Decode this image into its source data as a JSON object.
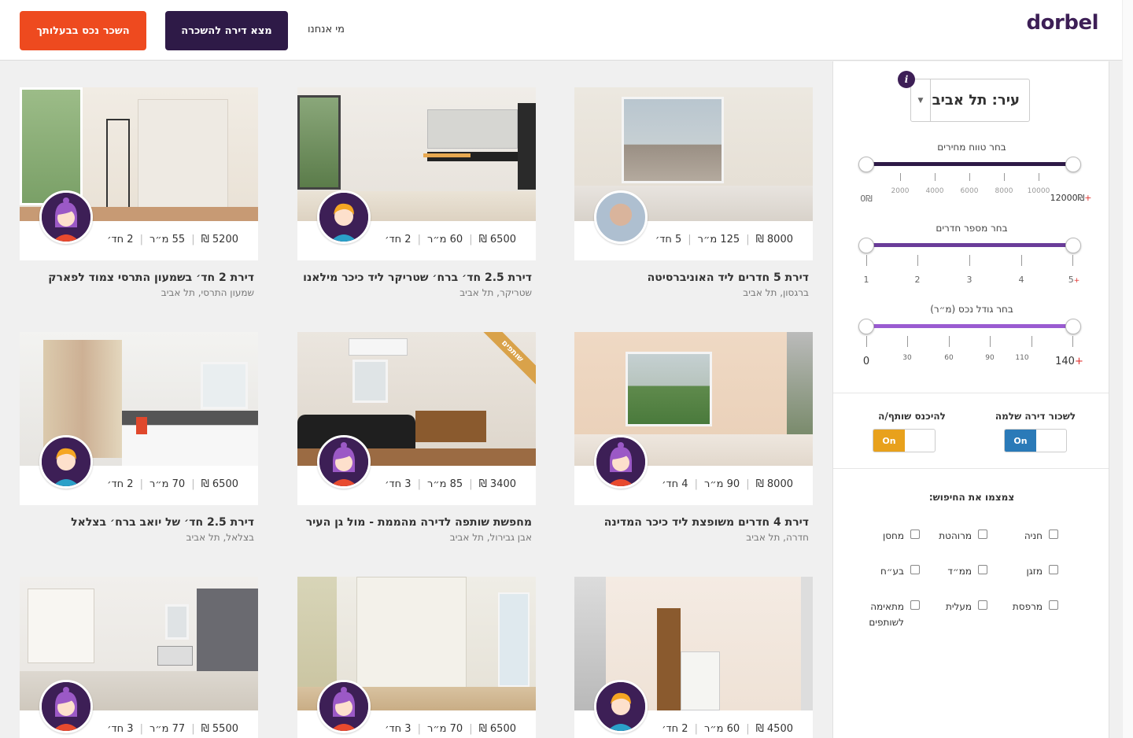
{
  "header": {
    "logo": "dorbel",
    "list_property_button": "השכר נכס בבעלותך",
    "find_apartment_button": "מצא דירה להשכרה",
    "about_link": "מי אנחנו"
  },
  "filters": {
    "city_label": "עיר: תל אביב",
    "info_icon": "i",
    "price": {
      "title": "בחר טווח מחירים",
      "min_label": "0₪",
      "max_label": "12000₪",
      "max_plus": "+",
      "ticks": [
        "2000",
        "4000",
        "6000",
        "8000",
        "10000"
      ],
      "range": [
        0,
        12000
      ],
      "color": "#2e1a47"
    },
    "rooms": {
      "title": "בחר מספר חדרים",
      "ticks": [
        "1",
        "2",
        "3",
        "4",
        "5"
      ],
      "max_plus": "+",
      "range": [
        1,
        5
      ],
      "color": "#6a3c99"
    },
    "size": {
      "title": "בחר גודל נכס (מ״ר)",
      "ticks": [
        "0",
        "30",
        "60",
        "90",
        "110",
        "140"
      ],
      "max_plus": "+",
      "range": [
        0,
        140
      ],
      "color": "#9a5bd1"
    },
    "toggles": [
      {
        "title": "לשכור דירה שלמה",
        "state": "On",
        "color": "#2a7ab8"
      },
      {
        "title": "להיכנס שותף/ה",
        "state": "On",
        "color": "#e8a11c"
      }
    ],
    "refine_title": "צמצמו את החיפוש:",
    "checkboxes": [
      "חניה",
      "מרוהטת",
      "מחסן",
      "מזגן",
      "ממ״ד",
      "בע״ח",
      "מרפסת",
      "מעלית",
      "מתאימה לשותפים"
    ]
  },
  "listings": [
    {
      "price": "8000 ₪",
      "size": "125 מ״ר",
      "rooms": "5 חד׳",
      "title": "דירת 5 חדרים ליד האוניברסיטה",
      "location": "ברגסון, תל אביב",
      "avatar": "photo-avatar"
    },
    {
      "price": "6500 ₪",
      "size": "60 מ״ר",
      "rooms": "2 חד׳",
      "title": "דירת 2.5 חד׳ ברח׳ שטריקר ליד כיכר מילאנו",
      "location": "שטריקר, תל אביב",
      "avatar": "boy-avatar"
    },
    {
      "price": "5200 ₪",
      "size": "55 מ״ר",
      "rooms": "2 חד׳",
      "title": "דירת 2 חד׳ בשמעון התרסי צמוד לפארק",
      "location": "שמעון התרסי, תל אביב",
      "avatar": "girl-avatar"
    },
    {
      "price": "8000 ₪",
      "size": "90 מ״ר",
      "rooms": "4 חד׳",
      "title": "דירת 4 חדרים משופצת ליד כיכר המדינה",
      "location": "חדרה, תל אביב",
      "avatar": "girl-avatar"
    },
    {
      "price": "3400 ₪",
      "size": "85 מ״ר",
      "rooms": "3 חד׳",
      "title": "מחפשת שותפה לדירה מהממת - מול גן העיר",
      "location": "אבן גבירול, תל אביב",
      "avatar": "girl-avatar",
      "ribbon": "שותפים"
    },
    {
      "price": "6500 ₪",
      "size": "70 מ״ר",
      "rooms": "2 חד׳",
      "title": "דירת 2.5 חד׳ של יואב ברח׳ בצלאל",
      "location": "בצלאל, תל אביב",
      "avatar": "boy-avatar"
    },
    {
      "price": "4500 ₪",
      "size": "60 מ״ר",
      "rooms": "2 חד׳",
      "title": "",
      "location": "",
      "avatar": "boy-avatar"
    },
    {
      "price": "6500 ₪",
      "size": "70 מ״ר",
      "rooms": "3 חד׳",
      "title": "",
      "location": "",
      "avatar": "girl-avatar"
    },
    {
      "price": "5500 ₪",
      "size": "77 מ״ר",
      "rooms": "3 חד׳",
      "title": "",
      "location": "",
      "avatar": "girl-avatar"
    }
  ]
}
